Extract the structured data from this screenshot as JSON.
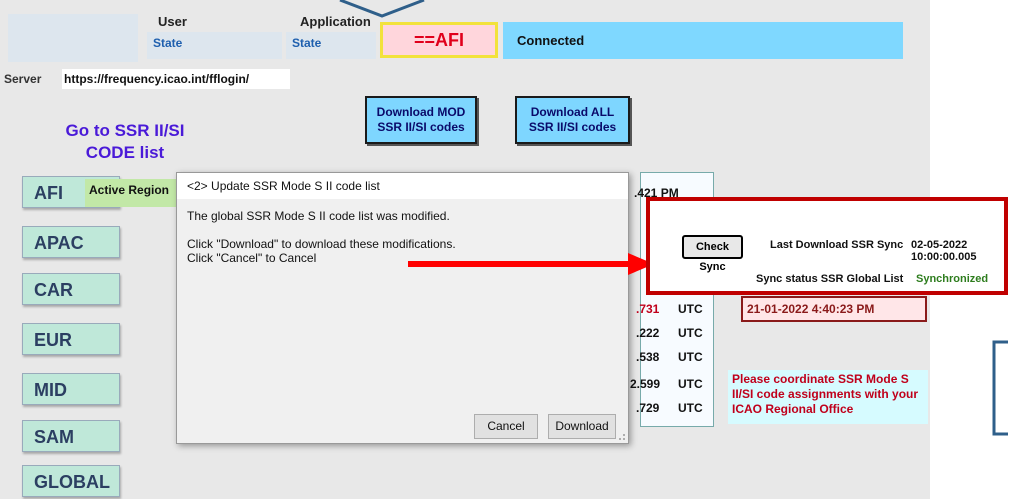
{
  "header": {
    "user_label": "User",
    "user_state": "State",
    "application_label": "Application",
    "application_state": "State",
    "active_region_value": "==AFI",
    "connection_value": "Connected"
  },
  "server": {
    "label": "Server",
    "url": "https://frequency.icao.int/fflogin/"
  },
  "buttons": {
    "download_mod": [
      "Download MOD",
      "SSR II/SI  codes"
    ],
    "download_all": [
      "Download ALL",
      "SSR II/SI codes"
    ]
  },
  "goto_link": [
    "Go to SSR II/SI",
    "CODE list"
  ],
  "regions": [
    "AFI",
    "APAC",
    "CAR",
    "EUR",
    "MID",
    "SAM",
    "GLOBAL"
  ],
  "active_region_label": "Active Region",
  "background_panel": {
    "top_time": ".421 PM",
    "utc_rows": [
      {
        "value": ".731",
        "unit": "UTC"
      },
      {
        "value": ".222",
        "unit": "UTC"
      },
      {
        "value": ".538",
        "unit": "UTC"
      },
      {
        "value": "2.599",
        "unit": "UTC"
      },
      {
        "value": ".729",
        "unit": "UTC"
      }
    ]
  },
  "dialog": {
    "title": "<2>  Update SSR Mode S II code list",
    "message": "The global SSR Mode S II code list was modified.",
    "instruction_1": "Click \"Download\" to download these modifications.",
    "instruction_2": "Click \"Cancel\" to Cancel",
    "cancel_label": "Cancel",
    "download_label": "Download"
  },
  "callout": {
    "check_sync_label": "Check Sync",
    "last_download_label": "Last Download SSR Sync",
    "last_download_value": "02-05-2022 10:00:00.005",
    "sync_status_label": "Sync status SSR Global List",
    "sync_status_value": "Synchronized"
  },
  "date_box_value": "21-01-2022 4:40:23 PM",
  "coordination_note": "Please coordinate SSR Mode S II/SI code assignments with your ICAO Regional Office",
  "colors": {
    "accent_blue": "#7fd8ff",
    "region_red": "#e0001b",
    "callout_border": "#c00000",
    "arrow_red": "#ff0000",
    "synchronized_green": "#2e7d1e"
  }
}
